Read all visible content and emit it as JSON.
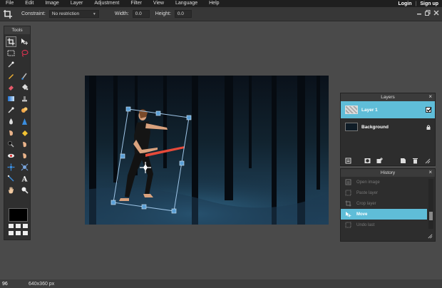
{
  "menu": {
    "items": [
      "File",
      "Edit",
      "Image",
      "Layer",
      "Adjustment",
      "Filter",
      "View",
      "Language",
      "Help"
    ],
    "login": "Login",
    "separator": "|",
    "signup": "Sign up"
  },
  "options": {
    "constraint_label": "Constraint:",
    "constraint_value": "No restriction",
    "width_label": "Width:",
    "width_value": "0.0",
    "height_label": "Height:",
    "height_value": "0.0"
  },
  "tools_panel": {
    "title": "Tools"
  },
  "layers_panel": {
    "title": "Layers",
    "layers": [
      {
        "name": "Layer 1",
        "selected": true,
        "visible": true
      },
      {
        "name": "Background",
        "selected": false,
        "locked": true
      }
    ]
  },
  "history_panel": {
    "title": "History",
    "items": [
      {
        "label": "Open image",
        "selected": false
      },
      {
        "label": "Paste layer",
        "selected": false
      },
      {
        "label": "Crop layer",
        "selected": false
      },
      {
        "label": "Move",
        "selected": true
      },
      {
        "label": "Undo last",
        "selected": false
      }
    ]
  },
  "status": {
    "zoom": "96",
    "dimensions": "640x360 px"
  },
  "colors": {
    "accent": "#5fbdd8",
    "menubar": "#1f1f1f",
    "workspace": "#4a4a4a",
    "panel": "#2d2d2d"
  }
}
